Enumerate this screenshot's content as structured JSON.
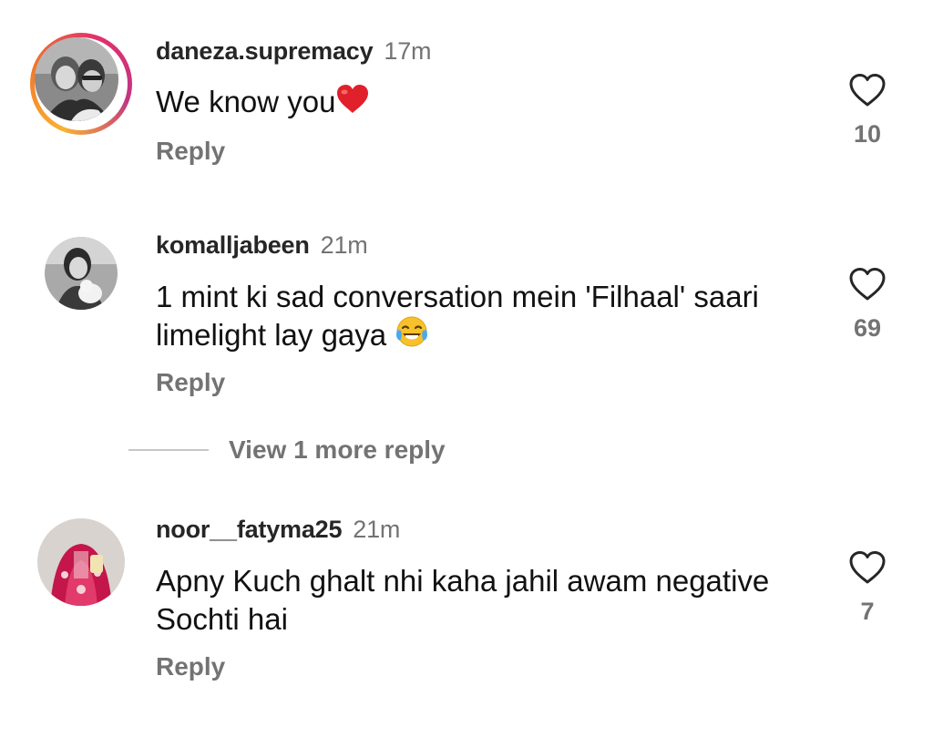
{
  "comments": [
    {
      "username": "daneza.supremacy",
      "time": "17m",
      "text": "We know you",
      "emoji": "heart",
      "reply_label": "Reply",
      "likes": "10"
    },
    {
      "username": "komalljabeen",
      "time": "21m",
      "text_line1": "1 mint ki sad conversation mein 'Filhaal' saari",
      "text_line2": "limelight lay gaya",
      "emoji": "face-with-tears-of-joy",
      "reply_label": "Reply",
      "likes": "69"
    },
    {
      "username": "noor__fatyma25",
      "time": "21m",
      "text_line1": "Apny Kuch ghalt nhi kaha jahil awam negative",
      "text_line2": "Sochti hai",
      "reply_label": "Reply",
      "likes": "7"
    }
  ],
  "view_more_label": "View 1 more reply",
  "colors": {
    "username": "#262626",
    "secondary": "#737373",
    "heart_outline": "#262626",
    "divider": "#c7c7c7"
  }
}
